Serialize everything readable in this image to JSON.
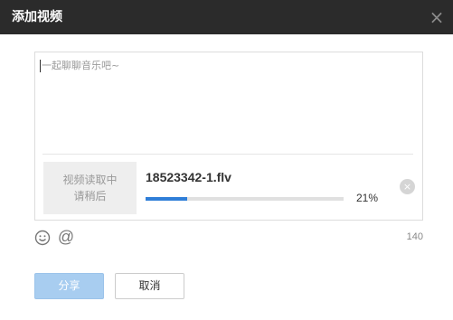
{
  "dialog": {
    "title": "添加视频",
    "close_symbol": "×"
  },
  "composer": {
    "placeholder": "一起聊聊音乐吧~"
  },
  "video": {
    "thumb_line1": "视频读取中",
    "thumb_line2": "请稍后",
    "filename": "18523342-1.flv",
    "progress": 0.21,
    "progress_label": "21%",
    "remove_symbol": "×"
  },
  "toolbar": {
    "emoji_icon": "smiley-icon",
    "at_symbol": "@",
    "char_count": "140"
  },
  "buttons": {
    "share_label": "分享",
    "cancel_label": "取消"
  },
  "colors": {
    "titlebar": "#2b2b2b",
    "progress_fill": "#2f7ed8",
    "share_disabled": "#a8cdf0"
  }
}
